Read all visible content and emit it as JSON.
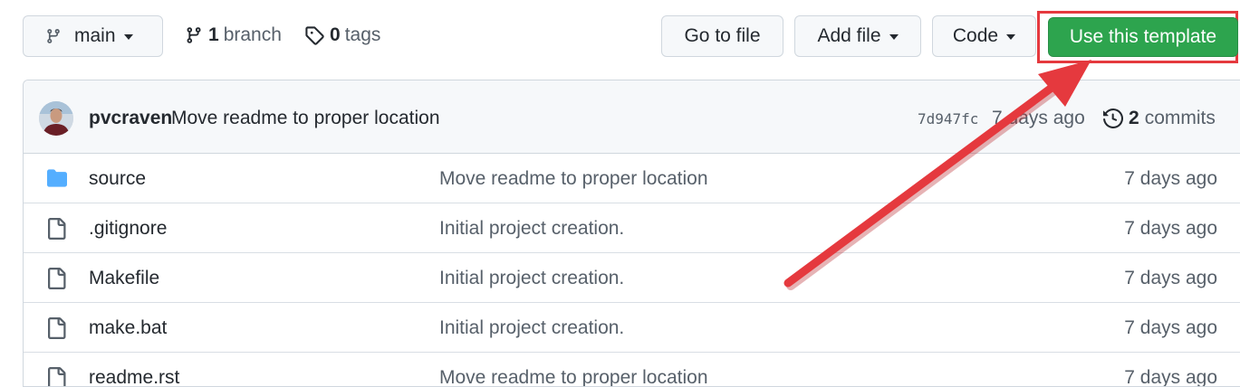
{
  "branch_selector": {
    "label": "main",
    "icon": "git-branch-icon"
  },
  "branches": {
    "count": "1",
    "label": "branch",
    "icon": "git-branch-icon"
  },
  "tags": {
    "count": "0",
    "label": "tags",
    "icon": "tag-icon"
  },
  "toolbar": {
    "goto_file": "Go to file",
    "add_file": "Add file",
    "code": "Code",
    "use_template": "Use this template"
  },
  "latest_commit": {
    "author": "pvcraven",
    "message": "Move readme to proper location",
    "sha": "7d947fc",
    "time": "7 days ago",
    "commits_count": "2",
    "commits_label": "commits"
  },
  "files": [
    {
      "name": "source",
      "type": "folder",
      "icon": "folder-icon",
      "message": "Move readme to proper location",
      "time": "7 days ago"
    },
    {
      "name": ".gitignore",
      "type": "file",
      "icon": "file-icon",
      "message": "Initial project creation.",
      "time": "7 days ago"
    },
    {
      "name": "Makefile",
      "type": "file",
      "icon": "file-icon",
      "message": "Initial project creation.",
      "time": "7 days ago"
    },
    {
      "name": "make.bat",
      "type": "file",
      "icon": "file-icon",
      "message": "Initial project creation.",
      "time": "7 days ago"
    },
    {
      "name": "readme.rst",
      "type": "file",
      "icon": "file-icon",
      "message": "Move readme to proper location",
      "time": "7 days ago"
    }
  ],
  "colors": {
    "primary_button": "#2da44e",
    "annotation": "#e5393e",
    "folder": "#54aeff"
  }
}
